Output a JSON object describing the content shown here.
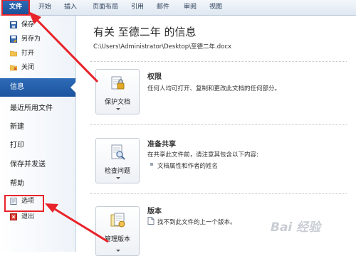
{
  "ribbon": {
    "tabs": [
      "文件",
      "开始",
      "插入",
      "页面布局",
      "引用",
      "邮件",
      "审阅",
      "视图"
    ]
  },
  "nav": {
    "small_items": [
      {
        "label": "保存",
        "icon": "save-icon"
      },
      {
        "label": "另存为",
        "icon": "save-as-icon"
      },
      {
        "label": "打开",
        "icon": "open-folder-icon"
      },
      {
        "label": "关闭",
        "icon": "close-folder-icon"
      }
    ],
    "info": "信息",
    "recent": "最近所用文件",
    "new": "新建",
    "print": "打印",
    "save_send": "保存并发送",
    "help": "帮助",
    "options": "选项",
    "exit": "退出"
  },
  "main": {
    "title": "有关 至德二年 的信息",
    "path": "C:\\Users\\Administrator\\Desktop\\至德二年.docx",
    "sections": [
      {
        "button": "保护文档",
        "title": "权限",
        "lines": [
          "任何人均可打开、复制和更改此文档的任何部分。"
        ]
      },
      {
        "button": "检查问题",
        "title": "准备共享",
        "lines": [
          "在共享此文件前，请注意其包含以下内容:"
        ],
        "bullets": [
          "文档属性和作者的姓名"
        ]
      },
      {
        "button": "管理版本",
        "title": "版本",
        "lines": [
          "找不到此文件的上一个版本。"
        ]
      }
    ]
  },
  "colors": {
    "accent": "#1d54a0",
    "highlight": "#e8232a"
  },
  "watermark": "Bai 经验"
}
